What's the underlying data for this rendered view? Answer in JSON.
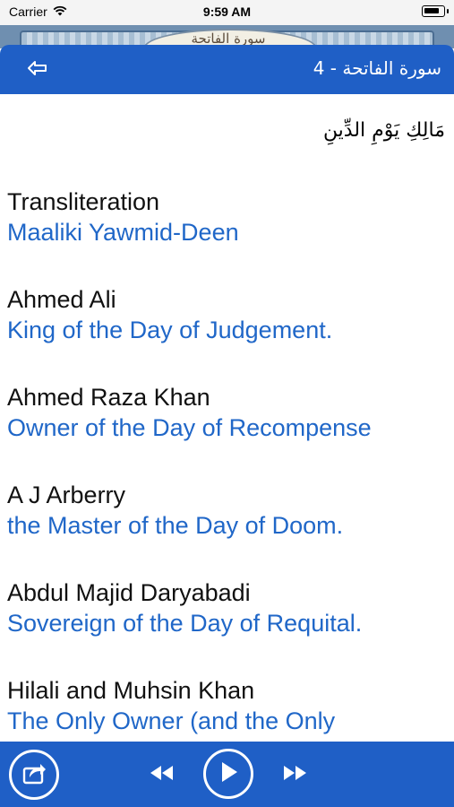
{
  "status_bar": {
    "carrier": "Carrier",
    "time": "9:59 AM",
    "battery_level": 0.85
  },
  "header_art": {
    "title": "سورة الفاتحة"
  },
  "nav": {
    "title": "سورة الفاتحة - 4",
    "back_icon": "back-arrow-icon"
  },
  "verse": {
    "arabic": "مَالِكِ يَوْمِ الدِّينِ"
  },
  "translations": [
    {
      "author": "Transliteration",
      "text": "Maaliki Yawmid-Deen"
    },
    {
      "author": "Ahmed Ali",
      "text": "King of the Day of Judgement."
    },
    {
      "author": "Ahmed Raza Khan",
      "text": "Owner of the Day of Recompense"
    },
    {
      "author": "A J Arberry",
      "text": "the Master of the Day of Doom."
    },
    {
      "author": "Abdul Majid Daryabadi",
      "text": "Sovereign of the Day of Requital."
    },
    {
      "author": "Hilali and Muhsin Khan",
      "text": "The Only Owner (and the Only"
    }
  ],
  "player": {
    "icons": [
      "share-icon",
      "rewind-icon",
      "play-icon",
      "fast-forward-icon"
    ]
  },
  "colors": {
    "accent": "#1f5fc6",
    "translation_text": "#2067c8"
  }
}
